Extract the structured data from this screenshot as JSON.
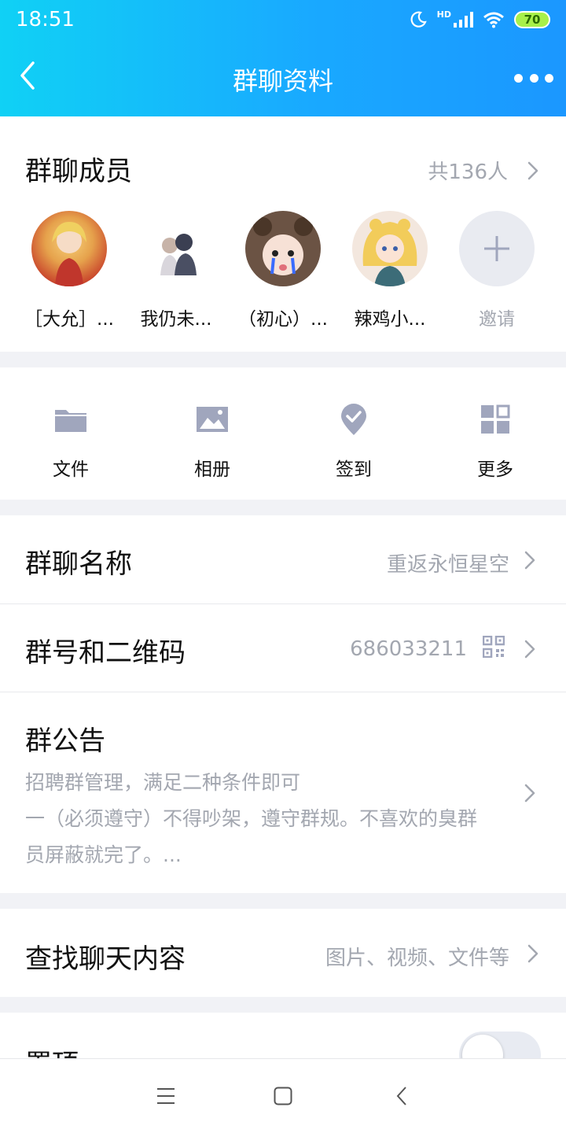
{
  "status_bar": {
    "time": "18:51",
    "network_label": "HD",
    "battery": "70",
    "icons": [
      "moon-icon",
      "signal-icon",
      "wifi-icon",
      "battery-icon"
    ]
  },
  "nav": {
    "title": "群聊资料",
    "back_icon": "chevron-left-icon",
    "more_icon": "more-dots-icon"
  },
  "members": {
    "title": "群聊成员",
    "count": "共136人",
    "list": [
      {
        "name": "［大允］..."
      },
      {
        "name": "我仍未..."
      },
      {
        "name": "（初心）..."
      },
      {
        "name": "辣鸡小..."
      }
    ],
    "invite_label": "邀请"
  },
  "tools": [
    {
      "label": "文件",
      "icon": "folder-icon"
    },
    {
      "label": "相册",
      "icon": "photo-icon"
    },
    {
      "label": "签到",
      "icon": "check-pin-icon"
    },
    {
      "label": "更多",
      "icon": "grid-icon"
    }
  ],
  "group_name": {
    "label": "群聊名称",
    "value": "重返永恒星空"
  },
  "group_id": {
    "label": "群号和二维码",
    "value": "686033211",
    "icon": "qr-code-icon"
  },
  "notice": {
    "label": "群公告",
    "lines": [
      "招聘群管理，满足二种条件即可",
      "一（必须遵守）不得吵架，遵守群规。不喜欢的臭群",
      "员屏蔽就完了。..."
    ]
  },
  "search_chat": {
    "label": "查找聊天内容",
    "value": "图片、视频、文件等"
  },
  "pin": {
    "label": "置顶"
  },
  "colors": {
    "header_start": "#10d1f5",
    "header_end": "#1b97ff",
    "secondary_text": "#a3a7b0",
    "icon_gray": "#a0a6bd"
  }
}
